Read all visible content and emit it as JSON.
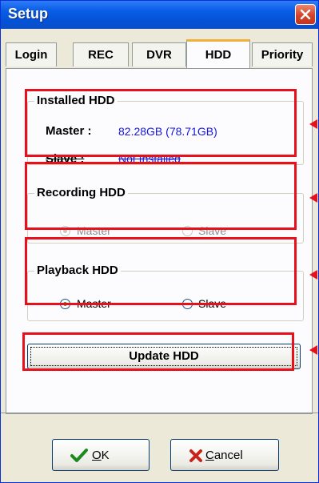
{
  "window": {
    "title": "Setup"
  },
  "tabs": [
    {
      "label": "Login"
    },
    {
      "label": "REC"
    },
    {
      "label": "DVR"
    },
    {
      "label": "HDD",
      "active": true
    },
    {
      "label": "Priority"
    }
  ],
  "installed_hdd": {
    "title": "Installed HDD",
    "master_label": "Master :",
    "master_value": "82.28GB (78.71GB)",
    "slave_label": "Slave  :",
    "slave_value": "Not Installed"
  },
  "recording_hdd": {
    "title": "Recording HDD",
    "options": [
      "Master",
      "Slave"
    ],
    "selected": "Master",
    "enabled": false
  },
  "playback_hdd": {
    "title": "Playback  HDD",
    "options": [
      "Master",
      "Slave"
    ],
    "selected": "Master"
  },
  "update_button": {
    "label": "Update HDD"
  },
  "ok_button": {
    "label": "OK",
    "mnemonic": "O"
  },
  "cancel_button": {
    "label": "Cancel",
    "mnemonic": "C"
  },
  "colors": {
    "highlight": "#E8101A",
    "title_bar": "#0A5DE6",
    "value_text": "#1515E0"
  },
  "icons": {
    "close": "close-icon",
    "ok": "checkmark-icon",
    "cancel": "x-icon"
  }
}
